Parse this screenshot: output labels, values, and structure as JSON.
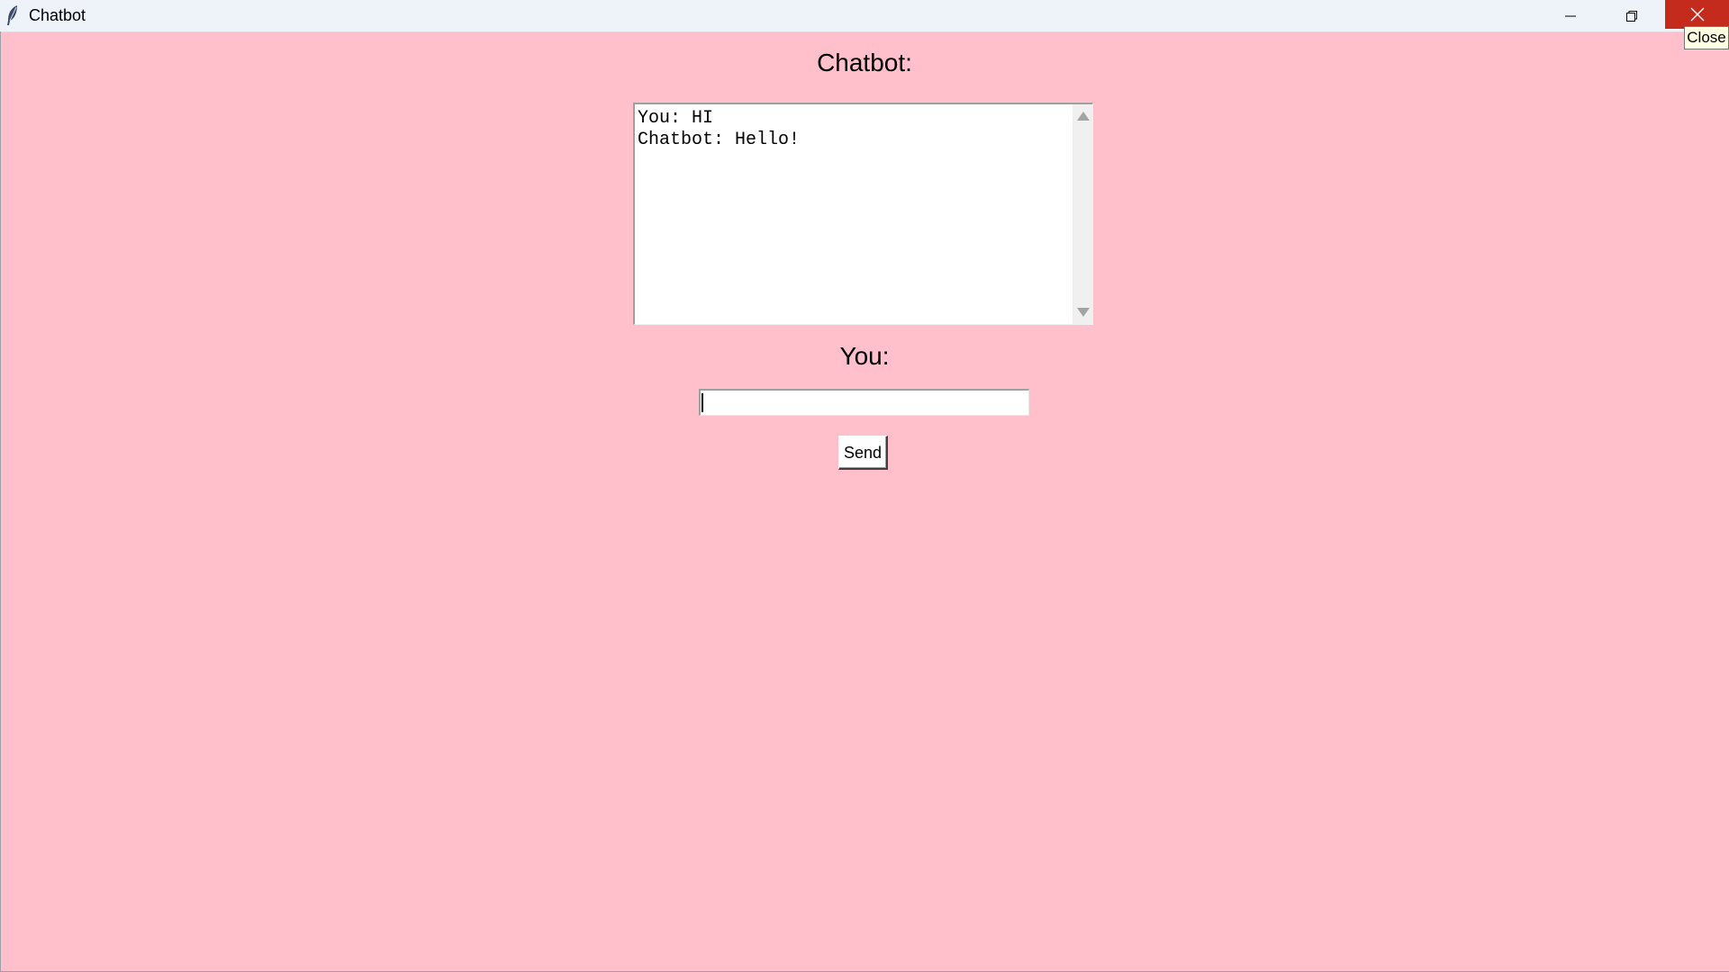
{
  "window": {
    "title": "Chatbot",
    "background_color": "#ffc0cb",
    "close_tooltip": "Close",
    "close_color": "#c42b1c"
  },
  "icons": {
    "app": "feather-icon",
    "minimize": "minimize-icon",
    "maximize": "restore-icon",
    "close": "close-icon"
  },
  "main": {
    "chatbot_label": "Chatbot:",
    "chat_log": "You: HI\nChatbot: Hello!",
    "you_label": "You:",
    "input_value": "",
    "send_label": "Send"
  }
}
